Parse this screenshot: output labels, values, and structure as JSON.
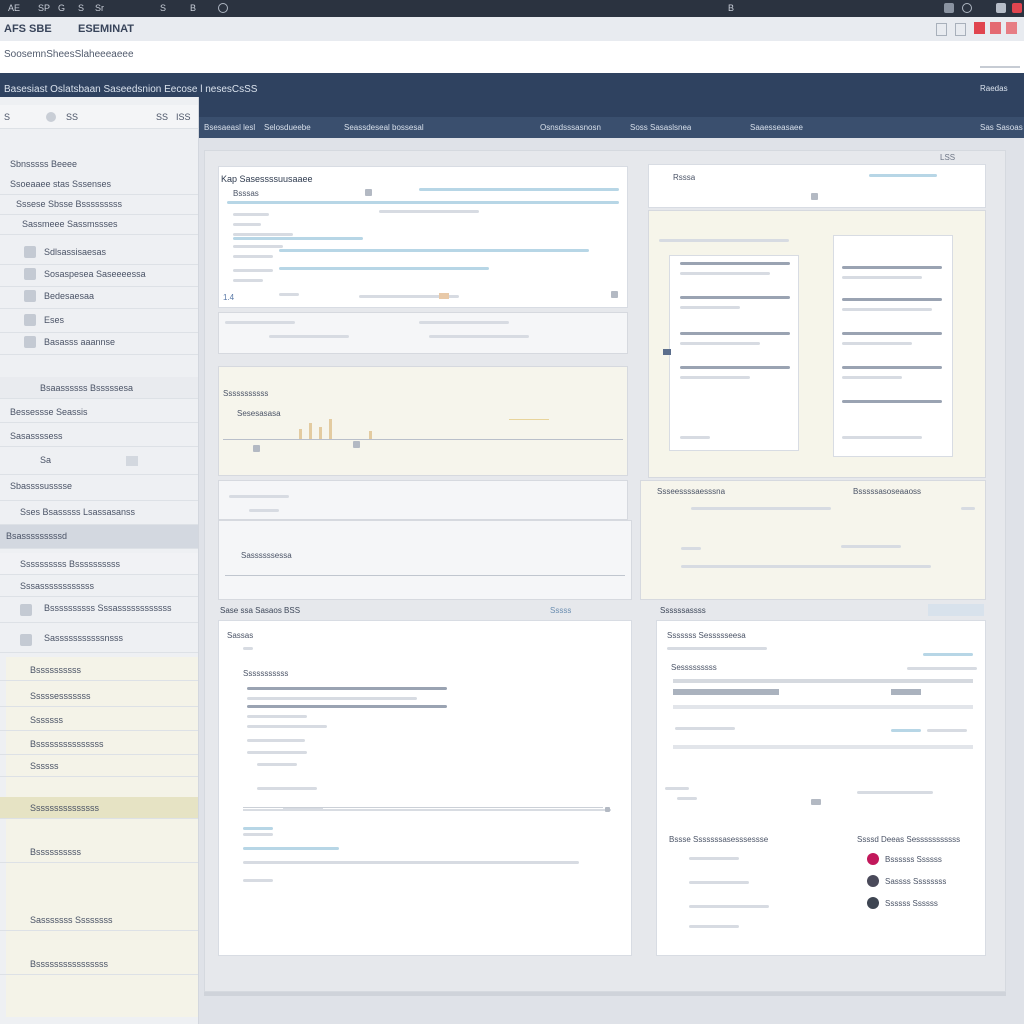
{
  "os_bar": {
    "left_items": [
      "AE",
      "SP",
      "G",
      "S",
      "Sr",
      "S",
      "B"
    ],
    "center_item": "B"
  },
  "app_header": {
    "title": "AFS SBE",
    "subtitle": "ESEMINAT"
  },
  "address_bar": {
    "value": "SoosemnSheesSlaheeeaeee"
  },
  "nav_title": {
    "text": "Basesiast Oslatsbaan Saseedsnion Eecose l nesesCsSS",
    "right_text": "Raedas"
  },
  "sub_nav": {
    "items": [
      "Bsesaeasl lesl",
      "Selosdueebe",
      "Seassdeseal bossesal",
      "Osnsdsssasnosn",
      "Soss Sasaslsnea",
      "Saaesseasaee"
    ],
    "right_text": "Sas Sasoas"
  },
  "sidebar": {
    "top": {
      "label1": "S",
      "label2": "SS",
      "label3": "SS",
      "label4": "ISS"
    },
    "items": [
      "Sbnsssss Beeee",
      "Ssoeaaee stas Sssenses",
      "Sssese Sbsse Bsssssssss",
      "Sassmeee Sassmssses",
      "Sdlsassisaesas",
      "Sosaspesea Saseeeessa",
      "Bedesaesaa",
      "Eses",
      "Basasss aaannse",
      "Bsaassssss Bsssssesa",
      "Bessessse Seassis",
      "Sasassssess",
      "Sa",
      "Sbassssusssse",
      "Sses Bsasssss Lsassasanss",
      "Bsasssssssssd",
      "Ssssssssss Bssssssssss",
      "Sssassssssssssss",
      "Bssssssssss Sssassssssssssss",
      "Sasssssssssssnsss",
      "Bssssssssss",
      "Sssssesssssss",
      "Sssssss",
      "Bsssssssssssssss",
      "Ssssss",
      "Sssssssssssssss",
      "Bssssssssss",
      "Sasssssss Ssssssss",
      "Bssssssssssssssss"
    ]
  },
  "panels": {
    "top_left": {
      "title": "Kap Sasessssuusaaee",
      "field": "Bsssas"
    },
    "top_right": {
      "title": "Rsssa",
      "badge": "LSS"
    },
    "mid_left": {
      "title": "Sssssssssss",
      "subtitle": "Sesesasasa"
    },
    "mid_right": {
      "title": "Ssseessssaesssna",
      "right": "Bsssssasoseaaoss"
    },
    "lower_left": {
      "title": "Sassssssessa"
    },
    "bottom_left": {
      "title": "Sase ssa Sasaos BSS",
      "tag": "Sssss",
      "label": "Sassas",
      "section": "Sssssssssss"
    },
    "bottom_right": {
      "title": "Ssssssassss",
      "heading": "Sssssss Sessssseesa",
      "sub": "Sesssssssss",
      "section_a": "Bssse Sssssssasesssessse",
      "section_b": "Ssssd Deeas Sesssssssssss"
    },
    "people": [
      {
        "name": "Bssssss Ssssss",
        "color": "#c2185b"
      },
      {
        "name": "Sassss Ssssssss",
        "color": "#4a4a5a"
      },
      {
        "name": "Ssssss Ssssss",
        "color": "#3e4552"
      }
    ]
  },
  "colors": {
    "nav": "#2f4260",
    "subnav": "#3a4f6e",
    "os": "#2b3340",
    "accent_red": "#e0454f"
  }
}
